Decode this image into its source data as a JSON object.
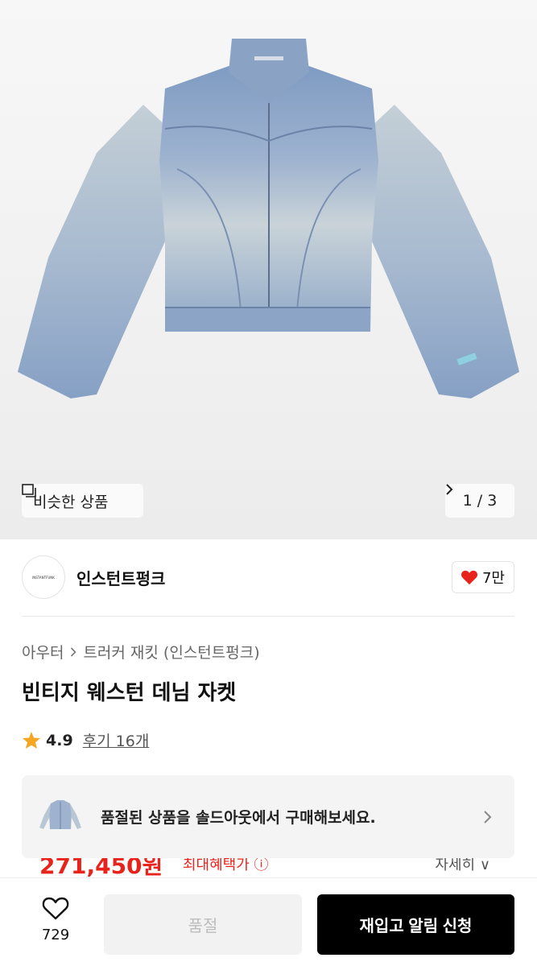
{
  "product_image": {
    "similar_label": "비슷한 상품",
    "pager": "1 / 3"
  },
  "brand": {
    "name": "인스턴트펑크",
    "logo_text": "INSTANTFUNK",
    "likes": "7만"
  },
  "breadcrumb": {
    "category": "아우터",
    "subcategory": "트러커 재킷 (인스턴트펑크)"
  },
  "product": {
    "title": "빈티지 웨스턴 데님 자켓",
    "rating": "4.9",
    "reviews": "후기 16개"
  },
  "soldout_banner": {
    "text": "품절된 상품을 솔드아웃에서 구매해보세요."
  },
  "price_peek": {
    "price": "271,450원",
    "promo": "최대혜택가 ⓘ",
    "option": "자세히 ∨"
  },
  "bottom_bar": {
    "wish_count": "729",
    "soldout_label": "품절",
    "restock_label": "재입고 알림 신청"
  },
  "colors": {
    "accent_red": "#e8231c",
    "star": "#f5a623",
    "heart": "#e8231c",
    "denim": "#8fa6c6"
  }
}
